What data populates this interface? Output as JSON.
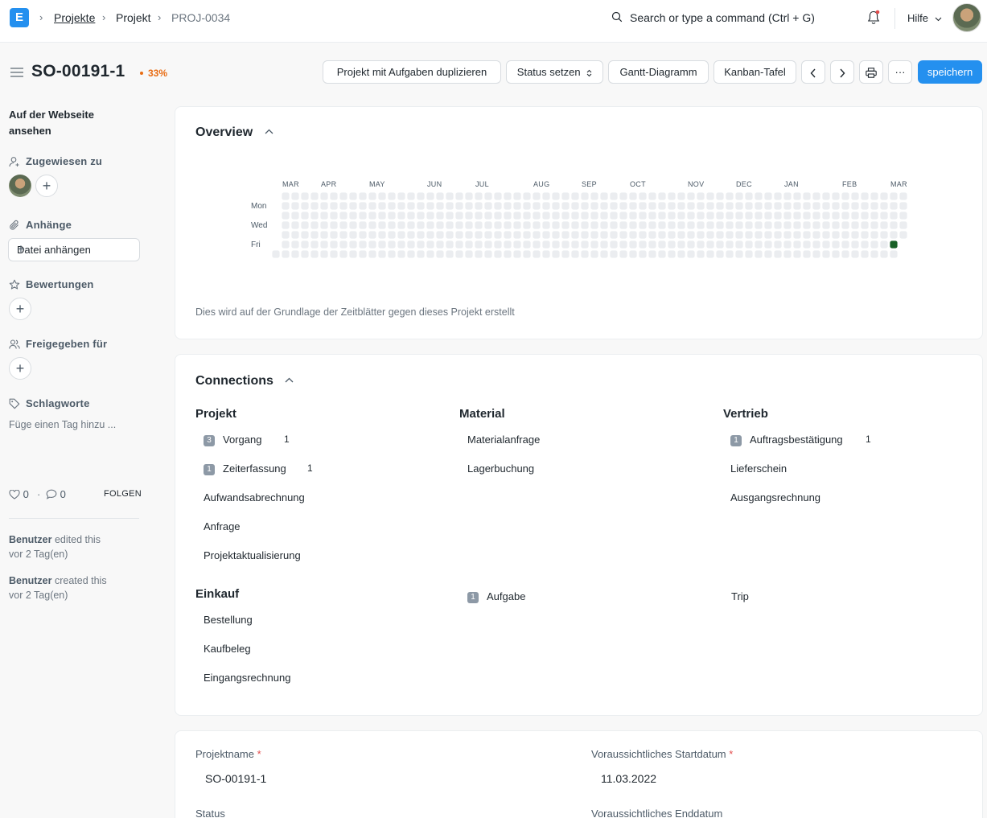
{
  "navbar": {
    "logo_letter": "E",
    "breadcrumbs": [
      "Projekte",
      "Projekt",
      "PROJ-0034"
    ],
    "search_placeholder": "Search or type a command (Ctrl + G)",
    "help_label": "Hilfe"
  },
  "header": {
    "title": "SO-00191-1",
    "progress": "33%",
    "buttons": {
      "duplicate": "Projekt mit Aufgaben duplizieren",
      "status": "Status setzen",
      "gantt": "Gantt-Diagramm",
      "kanban": "Kanban-Tafel",
      "more": "···",
      "save": "speichern"
    }
  },
  "sidebar": {
    "view_website": "Auf der Webseite ansehen",
    "assigned_to": "Zugewiesen zu",
    "attachments": "Anhänge",
    "attach_file": "Datei anhängen",
    "reviews": "Bewertungen",
    "shared_with": "Freigegeben für",
    "tags": "Schlagworte",
    "tag_placeholder": "Füge einen Tag hinzu ...",
    "likes": "0",
    "comments": "0",
    "follow": "FOLGEN",
    "activity": [
      {
        "user": "Benutzer",
        "action": " edited this",
        "time": "vor 2 Tag(en)"
      },
      {
        "user": "Benutzer",
        "action": " created this",
        "time": "vor 2 Tag(en)"
      }
    ]
  },
  "overview": {
    "title": "Overview",
    "months": [
      "MAR",
      "APR",
      "MAY",
      "JUN",
      "JUL",
      "AUG",
      "SEP",
      "OCT",
      "NOV",
      "DEC",
      "JAN",
      "FEB",
      "MAR"
    ],
    "days": [
      "Mon",
      "Wed",
      "Fri"
    ],
    "note": "Dies wird auf der Grundlage der Zeitblätter gegen dieses Projekt erstellt",
    "colors": {
      "empty": "#ebedf0",
      "active": "#196127"
    }
  },
  "connections": {
    "title": "Connections",
    "groups": {
      "projekt": {
        "heading": "Projekt",
        "items": [
          {
            "badge": "3",
            "label": "Vorgang",
            "count": "1"
          },
          {
            "badge": "1",
            "label": "Zeiterfassung",
            "count": "1"
          },
          {
            "label": "Aufwandsabrechnung"
          },
          {
            "label": "Anfrage"
          },
          {
            "label": "Projektaktualisierung"
          }
        ]
      },
      "material": {
        "heading": "Material",
        "items": [
          {
            "label": "Materialanfrage"
          },
          {
            "label": "Lagerbuchung"
          }
        ]
      },
      "vertrieb": {
        "heading": "Vertrieb",
        "items": [
          {
            "badge": "1",
            "label": "Auftragsbestätigung",
            "count": "1"
          },
          {
            "label": "Lieferschein"
          },
          {
            "label": "Ausgangsrechnung"
          }
        ]
      },
      "einkauf": {
        "heading": "Einkauf",
        "items": [
          {
            "label": "Bestellung"
          },
          {
            "label": "Kaufbeleg"
          },
          {
            "label": "Eingangsrechnung"
          }
        ]
      },
      "other": {
        "task": {
          "badge": "1",
          "label": "Aufgabe"
        },
        "trip": {
          "label": "Trip"
        }
      }
    }
  },
  "form": {
    "project_name_label": "Projektname",
    "project_name_value": "SO-00191-1",
    "start_date_label": "Voraussichtliches Startdatum",
    "start_date_value": "11.03.2022",
    "status_label": "Status",
    "end_date_label": "Voraussichtliches Enddatum"
  }
}
